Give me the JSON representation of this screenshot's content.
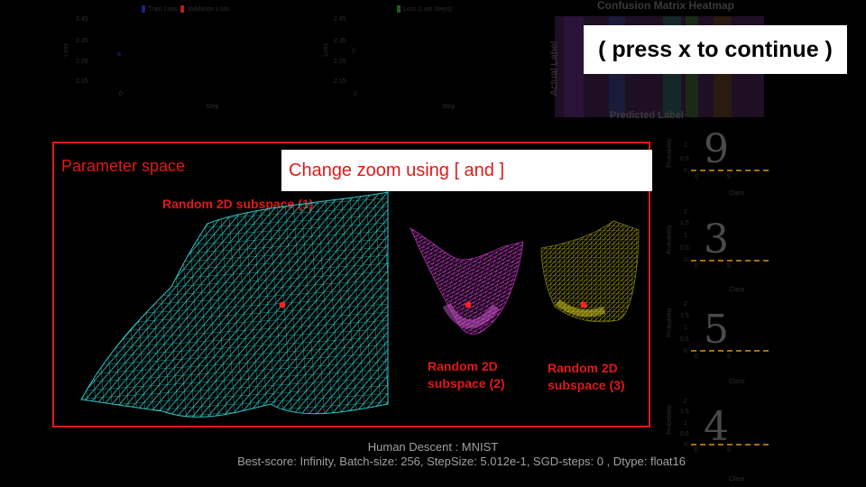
{
  "overlays": {
    "press_hint": "( press x to continue )",
    "zoom_hint": "Change zoom using [ and ]"
  },
  "loss_chart_1": {
    "legend": [
      {
        "label": "Train Loss",
        "color": "#1a237e"
      },
      {
        "label": "Validation Loss",
        "color": "#b71c1c"
      }
    ],
    "yticks": [
      "2.45",
      "2.35",
      "2.25",
      "2.15",
      "0"
    ],
    "ylabel": "Loss",
    "xlabel": "Step"
  },
  "loss_chart_2": {
    "legend": [
      {
        "label": "Loss (Last Steps)",
        "color": "#1b5e20"
      }
    ],
    "yticks": [
      "2.45",
      "2.35",
      "2.25",
      "2.15",
      "0"
    ],
    "ylabel": "Loss",
    "xlabel": "Step",
    "zero_label": "0"
  },
  "confusion": {
    "title": "Confusion Matrix Heatmap",
    "ylabel": "Actual Label",
    "xlabel": "Predicted Label"
  },
  "param_space": {
    "title": "Parameter space",
    "subspaces": [
      {
        "label": "Random 2D subspace (1)",
        "mesh_color": "#2ec4c4",
        "point_color": "#ff2020"
      },
      {
        "label": "Random 2D subspace (2)",
        "mesh_color": "#d63bd6",
        "point_color": "#ff2020"
      },
      {
        "label": "Random 2D subspace (3)",
        "mesh_color": "#c9c21a",
        "point_color": "#ff2020"
      }
    ]
  },
  "footer": {
    "title": "Human Descent : MNIST",
    "stats": "Best-score: Infinity, Batch-size: 256, StepSize: 5.012e-1, SGD-steps: 0 , Dtype: float16"
  },
  "digits": [
    {
      "digit": "9",
      "ylabel": "Probability",
      "xlabel": "Class",
      "yticks": [
        "1",
        "0.5",
        "0"
      ],
      "xticks": [
        "0",
        "5"
      ]
    },
    {
      "digit": "3",
      "ylabel": "Probability",
      "xlabel": "Class",
      "yticks": [
        "2",
        "1.5",
        "1",
        "0.5",
        "0"
      ],
      "xticks": [
        "0",
        "5"
      ]
    },
    {
      "digit": "5",
      "ylabel": "Probability",
      "xlabel": "Class",
      "yticks": [
        "2",
        "1.5",
        "1",
        "0.5",
        "0"
      ],
      "xticks": [
        "0",
        "5"
      ]
    },
    {
      "digit": "4",
      "ylabel": "Probability",
      "xlabel": "Class",
      "yticks": [
        "2",
        "1.5",
        "1",
        "0.5",
        "0"
      ],
      "xticks": [
        "0",
        "5"
      ]
    }
  ]
}
